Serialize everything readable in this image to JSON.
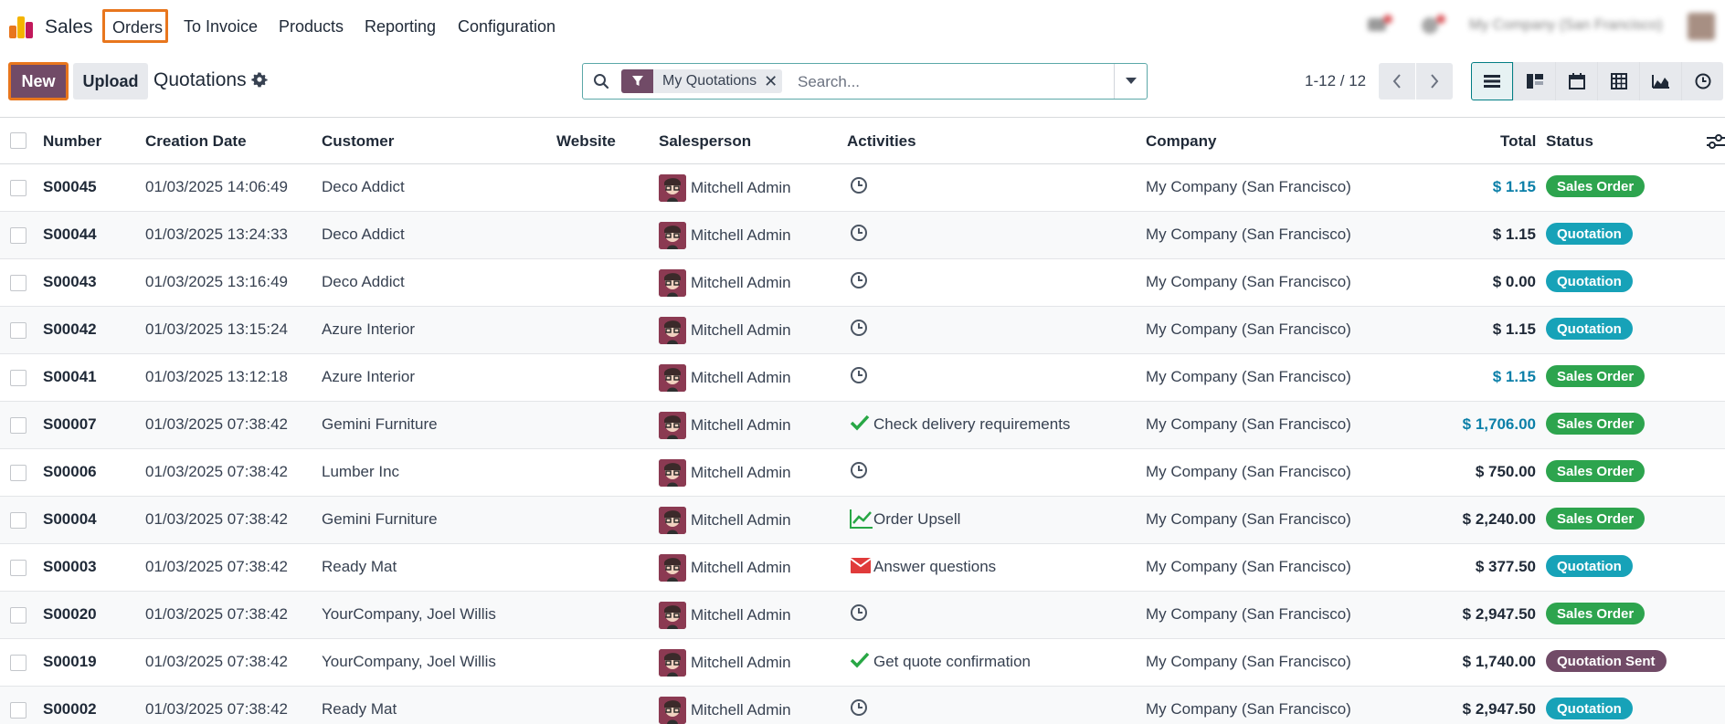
{
  "app": {
    "name": "Sales"
  },
  "menu": {
    "orders": "Orders",
    "to_invoice": "To Invoice",
    "products": "Products",
    "reporting": "Reporting",
    "configuration": "Configuration"
  },
  "navbar_right": {
    "company": "My Company (San Francisco)"
  },
  "toolbar": {
    "new_label": "New",
    "upload_label": "Upload",
    "title": "Quotations"
  },
  "search": {
    "facet": "My Quotations",
    "placeholder": "Search..."
  },
  "pager": {
    "value": "1-12 / 12"
  },
  "views": [
    "list",
    "kanban",
    "calendar",
    "pivot",
    "graph",
    "activity"
  ],
  "table": {
    "columns": {
      "number": "Number",
      "creation_date": "Creation Date",
      "customer": "Customer",
      "website": "Website",
      "salesperson": "Salesperson",
      "activities": "Activities",
      "company": "Company",
      "total": "Total",
      "status": "Status"
    },
    "rows": [
      {
        "number": "S00045",
        "date": "01/03/2025 14:06:49",
        "customer": "Deco Addict",
        "salesperson": "Mitchell Admin",
        "activity_icon": "clock-icon",
        "activity": "",
        "company": "My Company (San Francisco)",
        "total": "$ 1.15",
        "total_color": "blue",
        "status": "Sales Order",
        "status_kind": "so"
      },
      {
        "number": "S00044",
        "date": "01/03/2025 13:24:33",
        "customer": "Deco Addict",
        "salesperson": "Mitchell Admin",
        "activity_icon": "clock-icon",
        "activity": "",
        "company": "My Company (San Francisco)",
        "total": "$ 1.15",
        "total_color": "dark",
        "status": "Quotation",
        "status_kind": "q"
      },
      {
        "number": "S00043",
        "date": "01/03/2025 13:16:49",
        "customer": "Deco Addict",
        "salesperson": "Mitchell Admin",
        "activity_icon": "clock-icon",
        "activity": "",
        "company": "My Company (San Francisco)",
        "total": "$ 0.00",
        "total_color": "dark",
        "status": "Quotation",
        "status_kind": "q"
      },
      {
        "number": "S00042",
        "date": "01/03/2025 13:15:24",
        "customer": "Azure Interior",
        "salesperson": "Mitchell Admin",
        "activity_icon": "clock-icon",
        "activity": "",
        "company": "My Company (San Francisco)",
        "total": "$ 1.15",
        "total_color": "dark",
        "status": "Quotation",
        "status_kind": "q"
      },
      {
        "number": "S00041",
        "date": "01/03/2025 13:12:18",
        "customer": "Azure Interior",
        "salesperson": "Mitchell Admin",
        "activity_icon": "clock-icon",
        "activity": "",
        "company": "My Company (San Francisco)",
        "total": "$ 1.15",
        "total_color": "blue",
        "status": "Sales Order",
        "status_kind": "so"
      },
      {
        "number": "S00007",
        "date": "01/03/2025 07:38:42",
        "customer": "Gemini Furniture",
        "salesperson": "Mitchell Admin",
        "activity_icon": "check-icon",
        "activity": "Check delivery requirements",
        "company": "My Company (San Francisco)",
        "total": "$ 1,706.00",
        "total_color": "blue",
        "status": "Sales Order",
        "status_kind": "so"
      },
      {
        "number": "S00006",
        "date": "01/03/2025 07:38:42",
        "customer": "Lumber Inc",
        "salesperson": "Mitchell Admin",
        "activity_icon": "clock-icon",
        "activity": "",
        "company": "My Company (San Francisco)",
        "total": "$ 750.00",
        "total_color": "dark",
        "status": "Sales Order",
        "status_kind": "so"
      },
      {
        "number": "S00004",
        "date": "01/03/2025 07:38:42",
        "customer": "Gemini Furniture",
        "salesperson": "Mitchell Admin",
        "activity_icon": "chart-line-icon",
        "activity": "Order Upsell",
        "company": "My Company (San Francisco)",
        "total": "$ 2,240.00",
        "total_color": "dark",
        "status": "Sales Order",
        "status_kind": "so"
      },
      {
        "number": "S00003",
        "date": "01/03/2025 07:38:42",
        "customer": "Ready Mat",
        "salesperson": "Mitchell Admin",
        "activity_icon": "envelope-icon",
        "activity": "Answer questions",
        "company": "My Company (San Francisco)",
        "total": "$ 377.50",
        "total_color": "dark",
        "status": "Quotation",
        "status_kind": "q"
      },
      {
        "number": "S00020",
        "date": "01/03/2025 07:38:42",
        "customer": "YourCompany, Joel Willis",
        "salesperson": "Mitchell Admin",
        "activity_icon": "clock-icon",
        "activity": "",
        "company": "My Company (San Francisco)",
        "total": "$ 2,947.50",
        "total_color": "dark",
        "status": "Sales Order",
        "status_kind": "so"
      },
      {
        "number": "S00019",
        "date": "01/03/2025 07:38:42",
        "customer": "YourCompany, Joel Willis",
        "salesperson": "Mitchell Admin",
        "activity_icon": "check-icon",
        "activity": "Get quote confirmation",
        "company": "My Company (San Francisco)",
        "total": "$ 1,740.00",
        "total_color": "dark",
        "status": "Quotation Sent",
        "status_kind": "qs"
      },
      {
        "number": "S00002",
        "date": "01/03/2025 07:38:42",
        "customer": "Ready Mat",
        "salesperson": "Mitchell Admin",
        "activity_icon": "clock-icon",
        "activity": "",
        "company": "My Company (San Francisco)",
        "total": "$ 2,947.50",
        "total_color": "dark",
        "status": "Quotation",
        "status_kind": "q"
      }
    ]
  },
  "colors": {
    "brand": "#714b67",
    "highlight": "#e8761d",
    "sales_order": "#2da44e",
    "quotation": "#17a2b8",
    "blue_total": "#0b7fa8"
  }
}
